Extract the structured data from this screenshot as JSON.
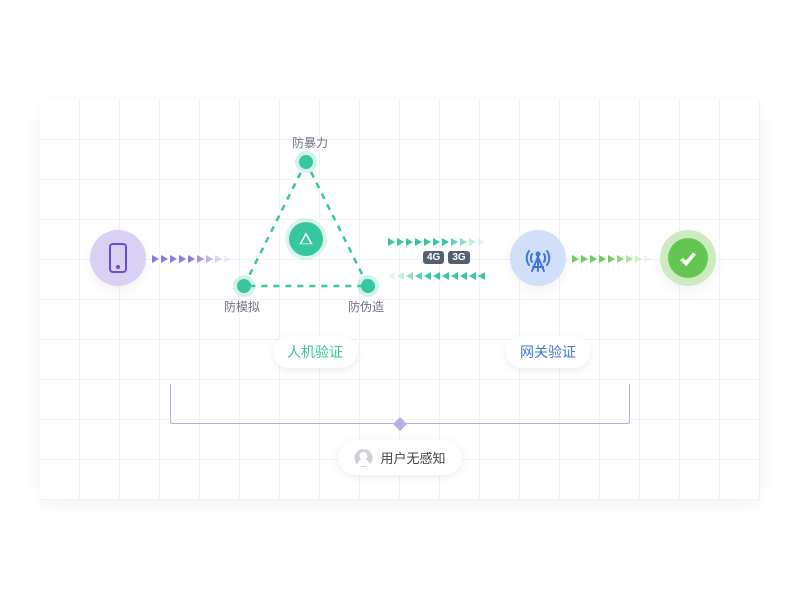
{
  "diagram": {
    "triangle": {
      "top": "防暴力",
      "left": "防模拟",
      "right": "防伪造"
    },
    "captions": {
      "human_verify": "人机验证",
      "gateway_verify": "网关验证"
    },
    "network_badges": [
      "4G",
      "3G"
    ],
    "bottom_label": "用户无感知",
    "icons": {
      "phone": "phone-icon",
      "antenna": "antenna-icon",
      "check": "check-icon",
      "user": "user-icon",
      "triangle_center": "shield-triangle-icon"
    },
    "colors": {
      "purple": "#8f77e5",
      "teal": "#36c7a0",
      "blue": "#4076d6",
      "green": "#6ccf5c"
    }
  }
}
